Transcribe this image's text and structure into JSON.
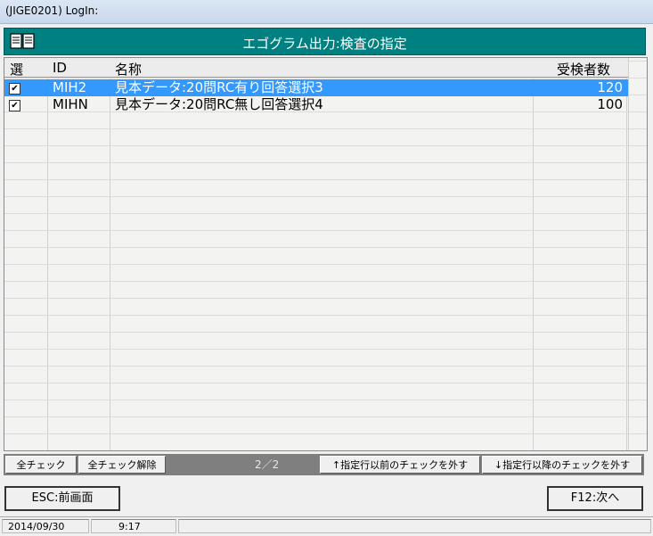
{
  "window": {
    "title": "(JIGE0201)  LogIn:"
  },
  "header": {
    "title": "エゴグラム出力:検査の指定",
    "icon": "book-icon"
  },
  "grid": {
    "columns": [
      "選",
      "ID",
      "名称",
      "受検者数"
    ],
    "rows": [
      {
        "checked": true,
        "id": "MIH2",
        "name": "見本データ:20問RC有り回答選択3",
        "count": "120",
        "selected": true
      },
      {
        "checked": true,
        "id": "MIHN",
        "name": "見本データ:20問RC無し回答選択4",
        "count": "100",
        "selected": false
      }
    ]
  },
  "toolbar": {
    "check_all": "全チェック",
    "uncheck_all": "全チェック解除",
    "page": "2／2",
    "uncheck_before": "↑指定行以前のチェックを外す",
    "uncheck_after": "↓指定行以降のチェックを外す"
  },
  "nav": {
    "back": "ESC:前画面",
    "next": "F12:次へ"
  },
  "status": {
    "date": "2014/09/30",
    "time": "9:17"
  },
  "colors": {
    "header": "#008080",
    "selection": "#3399ff"
  }
}
